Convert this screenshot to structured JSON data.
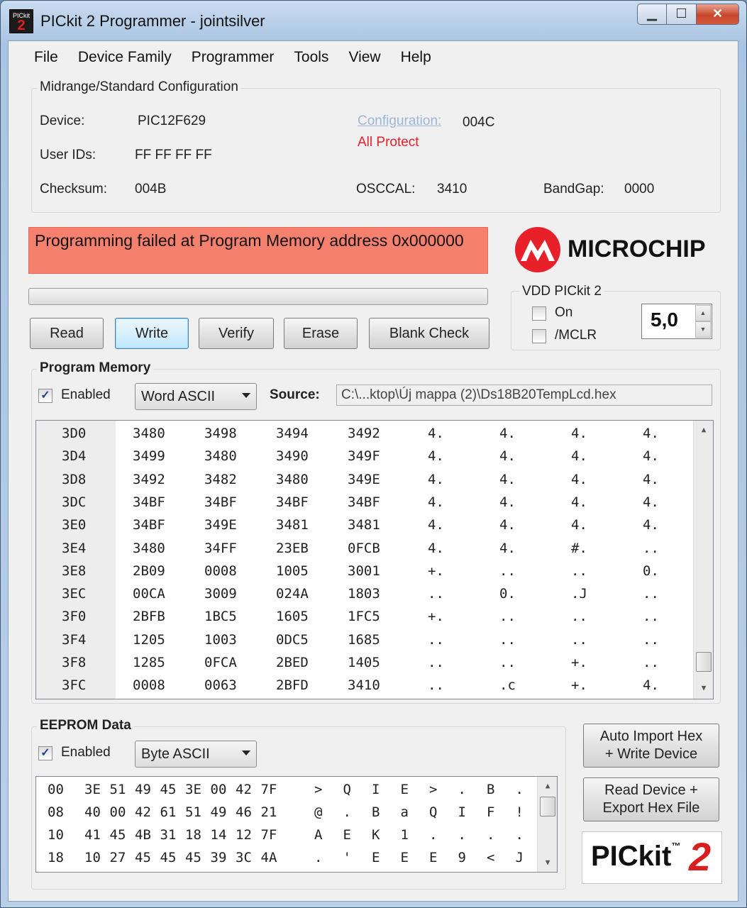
{
  "window": {
    "title": "PICkit 2 Programmer - jointsilver",
    "icon_text_top": "PICkit",
    "icon_text_big": "2"
  },
  "menu": [
    "File",
    "Device Family",
    "Programmer",
    "Tools",
    "View",
    "Help"
  ],
  "config": {
    "group_title": "Midrange/Standard Configuration",
    "device_label": "Device:",
    "device_value": "PIC12F629",
    "configuration_link": "Configuration:",
    "configuration_value": "004C",
    "protect_status": "All Protect",
    "userids_label": "User IDs:",
    "userids_value": "FF FF FF FF",
    "checksum_label": "Checksum:",
    "checksum_value": "004B",
    "osccal_label": "OSCCAL:",
    "osccal_value": "3410",
    "bandgap_label": "BandGap:",
    "bandgap_value": "0000"
  },
  "status": {
    "message": "Programming failed at Program Memory address 0x000000",
    "color": "#f6806e"
  },
  "logo": {
    "text": "MICROCHIP",
    "color": "#e8202a"
  },
  "buttons": {
    "read": "Read",
    "write": "Write",
    "verify": "Verify",
    "erase": "Erase",
    "blank_check": "Blank Check"
  },
  "vdd": {
    "group_title": "VDD PICkit 2",
    "on_label": "On",
    "on_checked": false,
    "mclr_label": "/MCLR",
    "mclr_checked": false,
    "voltage": "5,0"
  },
  "program_memory": {
    "group_title": "Program Memory",
    "enabled_label": "Enabled",
    "enabled_checked": true,
    "mode": "Word ASCII",
    "source_label": "Source:",
    "source_path": "C:\\...ktop\\Új mappa (2)\\Ds18B20TempLcd.hex",
    "rows": [
      {
        "addr": "3D0",
        "words": [
          "3480",
          "3498",
          "3494",
          "3492"
        ],
        "ascii": [
          "4.",
          "4.",
          "4.",
          "4."
        ]
      },
      {
        "addr": "3D4",
        "words": [
          "3499",
          "3480",
          "3490",
          "349F"
        ],
        "ascii": [
          "4.",
          "4.",
          "4.",
          "4."
        ]
      },
      {
        "addr": "3D8",
        "words": [
          "3492",
          "3482",
          "3480",
          "349E"
        ],
        "ascii": [
          "4.",
          "4.",
          "4.",
          "4."
        ]
      },
      {
        "addr": "3DC",
        "words": [
          "34BF",
          "34BF",
          "34BF",
          "34BF"
        ],
        "ascii": [
          "4.",
          "4.",
          "4.",
          "4."
        ]
      },
      {
        "addr": "3E0",
        "words": [
          "34BF",
          "349E",
          "3481",
          "3481"
        ],
        "ascii": [
          "4.",
          "4.",
          "4.",
          "4."
        ]
      },
      {
        "addr": "3E4",
        "words": [
          "3480",
          "34FF",
          "23EB",
          "0FCB"
        ],
        "ascii": [
          "4.",
          "4.",
          "#.",
          ".."
        ]
      },
      {
        "addr": "3E8",
        "words": [
          "2B09",
          "0008",
          "1005",
          "3001"
        ],
        "ascii": [
          "+.",
          "..",
          "..",
          "0."
        ]
      },
      {
        "addr": "3EC",
        "words": [
          "00CA",
          "3009",
          "024A",
          "1803"
        ],
        "ascii": [
          "..",
          "0.",
          ".J",
          ".."
        ]
      },
      {
        "addr": "3F0",
        "words": [
          "2BFB",
          "1BC5",
          "1605",
          "1FC5"
        ],
        "ascii": [
          "+.",
          "..",
          "..",
          ".."
        ]
      },
      {
        "addr": "3F4",
        "words": [
          "1205",
          "1003",
          "0DC5",
          "1685"
        ],
        "ascii": [
          "..",
          "..",
          "..",
          ".."
        ]
      },
      {
        "addr": "3F8",
        "words": [
          "1285",
          "0FCA",
          "2BED",
          "1405"
        ],
        "ascii": [
          "..",
          "..",
          "+.",
          ".."
        ]
      },
      {
        "addr": "3FC",
        "words": [
          "0008",
          "0063",
          "2BFD",
          "3410"
        ],
        "ascii": [
          "..",
          ".c",
          "+.",
          "4."
        ]
      }
    ]
  },
  "eeprom": {
    "group_title": "EEPROM Data",
    "enabled_label": "Enabled",
    "enabled_checked": true,
    "mode": "Byte ASCII",
    "rows": [
      {
        "addr": "00",
        "bytes": [
          "3E",
          "51",
          "49",
          "45",
          "3E",
          "00",
          "42",
          "7F"
        ],
        "ascii": [
          ">",
          "Q",
          "I",
          "E",
          ">",
          ".",
          "B",
          "."
        ]
      },
      {
        "addr": "08",
        "bytes": [
          "40",
          "00",
          "42",
          "61",
          "51",
          "49",
          "46",
          "21"
        ],
        "ascii": [
          "@",
          ".",
          "B",
          "a",
          "Q",
          "I",
          "F",
          "!"
        ]
      },
      {
        "addr": "10",
        "bytes": [
          "41",
          "45",
          "4B",
          "31",
          "18",
          "14",
          "12",
          "7F"
        ],
        "ascii": [
          "A",
          "E",
          "K",
          "1",
          ".",
          ".",
          ".",
          "."
        ]
      },
      {
        "addr": "18",
        "bytes": [
          "10",
          "27",
          "45",
          "45",
          "45",
          "39",
          "3C",
          "4A"
        ],
        "ascii": [
          ".",
          "'",
          "E",
          "E",
          "E",
          "9",
          "<",
          "J"
        ]
      }
    ]
  },
  "side_buttons": {
    "auto_import_line1": "Auto Import Hex",
    "auto_import_line2": "+ Write Device",
    "read_export_line1": "Read Device +",
    "read_export_line2": "Export Hex File"
  },
  "pickit_logo": {
    "text": "PICkit",
    "tm": "™",
    "number": "2"
  }
}
